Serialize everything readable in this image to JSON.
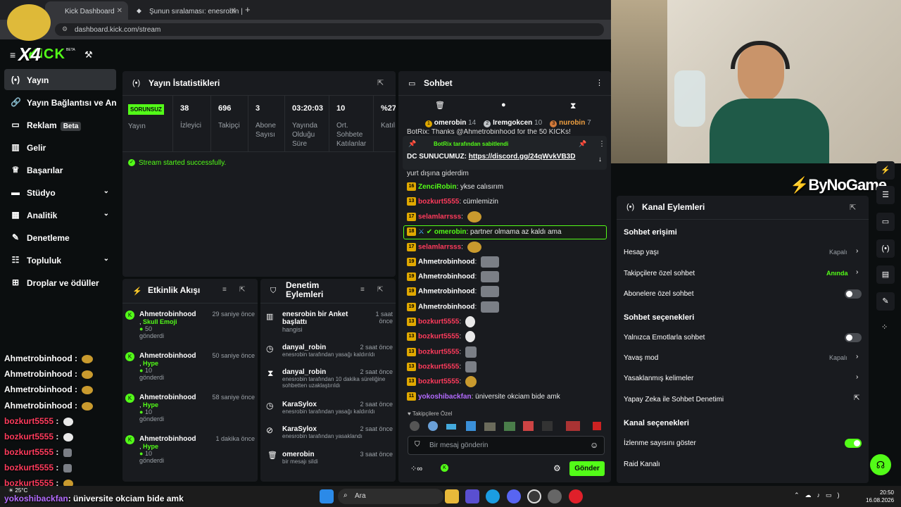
{
  "browser": {
    "tabs": [
      {
        "label": "Kick Dashboard"
      },
      {
        "label": "Şunun sıralaması: enesrobin | Yo"
      }
    ],
    "new_tab": "+",
    "url": "dashboard.kick.com/stream"
  },
  "header": {
    "logo": "KICK",
    "beta": "BETA"
  },
  "sidebar": {
    "items": [
      {
        "label": "Yayın",
        "icon": "broadcast-icon"
      },
      {
        "label": "Yayın Bağlantısı ve Anahtar",
        "icon": "link-icon"
      },
      {
        "label": "Reklam",
        "icon": "ad-icon",
        "badge": "Beta"
      },
      {
        "label": "Gelir",
        "icon": "chart-icon"
      },
      {
        "label": "Başarılar",
        "icon": "trophy-icon"
      },
      {
        "label": "Stüdyo",
        "icon": "studio-icon"
      },
      {
        "label": "Analitik",
        "icon": "analytics-icon"
      },
      {
        "label": "Denetleme",
        "icon": "wrench-icon"
      },
      {
        "label": "Topluluk",
        "icon": "community-icon"
      },
      {
        "label": "Droplar ve ödüller",
        "icon": "gift-icon"
      }
    ]
  },
  "stats": {
    "title": "Yayın İstatistikleri",
    "status_badge": "SORUNSUZ",
    "status_label": "Yayın",
    "items": [
      {
        "value": "38",
        "label": "İzleyici"
      },
      {
        "value": "696",
        "label": "Takipçi"
      },
      {
        "value": "3",
        "label": "Abone Sayısı"
      },
      {
        "value": "03:20:03",
        "label": "Yayında Olduğu Süre"
      },
      {
        "value": "10",
        "label": "Ort. Sohbete Katılanlar"
      },
      {
        "value": "%27",
        "label": "Katılı"
      }
    ],
    "success_msg": "Stream started successfully."
  },
  "activity": {
    "title": "Etkinlik Akışı",
    "events": [
      {
        "user": "Ahmetrobinhood",
        "item": "Skull Emoji",
        "amount": "50",
        "verb": "gönderdi",
        "time": "29 saniye önce"
      },
      {
        "user": "Ahmetrobinhood",
        "item": "Hype",
        "amount": "10",
        "verb": "gönderdi",
        "time": "50 saniye önce"
      },
      {
        "user": "Ahmetrobinhood",
        "item": "Hype",
        "amount": "10",
        "verb": "gönderdi",
        "time": "58 saniye önce"
      },
      {
        "user": "Ahmetrobinhood",
        "item": "Hype",
        "amount": "10",
        "verb": "gönderdi",
        "time": "1 dakika önce"
      }
    ]
  },
  "moderation": {
    "title": "Denetim Eylemleri",
    "actions": [
      {
        "user": "enesrobin",
        "action": "bir Anket başlattı",
        "detail": "hangisi",
        "time": "1 saat önce",
        "icon": "poll-icon"
      },
      {
        "user": "danyal_robin",
        "action": "",
        "detail": "enesrobin tarafından yasağı kaldırıldı",
        "time": "2 saat önce",
        "icon": "clock-icon"
      },
      {
        "user": "danyal_robin",
        "action": "",
        "detail": "enesrobin tarafından 10 dakika süreliğine sohbetten uzaklaştırıldı",
        "time": "2 saat önce",
        "icon": "hourglass-icon"
      },
      {
        "user": "KaraSylox",
        "action": "",
        "detail": "enesrobin tarafından yasağı kaldırıldı",
        "time": "2 saat önce",
        "icon": "clock-icon"
      },
      {
        "user": "KaraSylox",
        "action": "",
        "detail": "enesrobin tarafından yasaklandı",
        "time": "2 saat önce",
        "icon": "ban-icon"
      },
      {
        "user": "omerobin",
        "action": "",
        "detail": "bir mesajı sildi",
        "time": "3 saat önce",
        "icon": "trash-icon"
      }
    ]
  },
  "chat": {
    "title": "Sohbet",
    "leaderboard": [
      {
        "rank": "1",
        "name": "omerobin",
        "count": "14"
      },
      {
        "rank": "2",
        "name": "Iremgokcen",
        "count": "10"
      },
      {
        "rank": "3",
        "name": "nurobin",
        "count": "7"
      }
    ],
    "partial_top": "BotRix: Thanks @Ahmetrobinhood for the 50 KICKs!",
    "pinned_by": "BotRix tarafından sabitlendi",
    "pinned_msg": "DC SUNUCUMUZ: https://discord.gg/24qWvkVB3D",
    "pinned_prefix": "DC SUNUCUMUZ:",
    "pinned_link": "https://discord.gg/24qWvkVB3D",
    "partial_msg": "yurt dışına giderdim",
    "messages": [
      {
        "lvl": "16",
        "user": "ZenciRobin",
        "color": "#53fc18",
        "text": "ykse calısırım",
        "emote": ""
      },
      {
        "lvl": "13",
        "user": "bozkurt5555",
        "color": "#ff3b5c",
        "text": "cümlemizin",
        "emote": ""
      },
      {
        "lvl": "17",
        "user": "selamlarrsss",
        "color": "#ff3b5c",
        "text": "",
        "emote": "gold"
      },
      {
        "lvl": "18",
        "user": "omerobin",
        "color": "#53fc18",
        "text": "partner olmama az kaldı ama",
        "emote": "",
        "highlight": true
      },
      {
        "lvl": "17",
        "user": "selamlarrsss",
        "color": "#ff3b5c",
        "text": "",
        "emote": "gold"
      },
      {
        "lvl": "19",
        "user": "Ahmetrobinhood",
        "color": "#ffffff",
        "text": "",
        "emote": "gray"
      },
      {
        "lvl": "19",
        "user": "Ahmetrobinhood",
        "color": "#ffffff",
        "text": "",
        "emote": "gray"
      },
      {
        "lvl": "19",
        "user": "Ahmetrobinhood",
        "color": "#ffffff",
        "text": "",
        "emote": "gray"
      },
      {
        "lvl": "19",
        "user": "Ahmetrobinhood",
        "color": "#ffffff",
        "text": "",
        "emote": "gray"
      },
      {
        "lvl": "13",
        "user": "bozkurt5555",
        "color": "#ff3b5c",
        "text": "",
        "emote": "skull"
      },
      {
        "lvl": "13",
        "user": "bozkurt5555",
        "color": "#ff3b5c",
        "text": "",
        "emote": "skull"
      },
      {
        "lvl": "13",
        "user": "bozkurt5555",
        "color": "#ff3b5c",
        "text": "",
        "emote": "gray"
      },
      {
        "lvl": "13",
        "user": "bozkurt5555",
        "color": "#ff3b5c",
        "text": "",
        "emote": "gray"
      },
      {
        "lvl": "13",
        "user": "bozkurt5555",
        "color": "#ff3b5c",
        "text": "",
        "emote": "gold"
      },
      {
        "lvl": "11",
        "user": "yokoshibackfan",
        "color": "#b46bff",
        "text": "üniversite okciam bide amk",
        "emote": ""
      }
    ],
    "followers_only": "Takipçilere Özel",
    "placeholder": "Bir mesaj gönderin",
    "send": "Gönder"
  },
  "channel": {
    "watermark": "ByNoGame",
    "title": "Kanal Eylemleri",
    "sections": [
      {
        "heading": "Sohbet erişimi"
      },
      {
        "heading": "Sohbet seçenekleri"
      },
      {
        "heading": "Kanal seçenekleri"
      }
    ],
    "rows": [
      {
        "label": "Hesap yaşı",
        "value": "Kapalı"
      },
      {
        "label": "Takipçilere özel sohbet",
        "value": "Anında"
      },
      {
        "label": "Abonelere özel sohbet",
        "value": ""
      },
      {
        "label": "Yalnızca Emotlarla sohbet",
        "value": ""
      },
      {
        "label": "Yavaş mod",
        "value": "Kapalı"
      },
      {
        "label": "Yasaklanmış kelimeler",
        "value": ""
      },
      {
        "label": "Yapay Zeka ile Sohbet Denetimi",
        "value": ""
      },
      {
        "label": "İzlenme sayısını göster",
        "value": ""
      },
      {
        "label": "Raid Kanalı",
        "value": ""
      }
    ]
  },
  "overlay": {
    "badge": "X4",
    "lines": [
      {
        "user": "Ahmetrobinhood",
        "color": "#ffffff"
      },
      {
        "user": "Ahmetrobinhood",
        "color": "#ffffff"
      },
      {
        "user": "Ahmetrobinhood",
        "color": "#ffffff"
      },
      {
        "user": "Ahmetrobinhood",
        "color": "#ffffff"
      },
      {
        "user": "bozkurt5555",
        "color": "#ff3b5c"
      },
      {
        "user": "bozkurt5555",
        "color": "#ff3b5c"
      },
      {
        "user": "bozkurt5555",
        "color": "#ff3b5c"
      },
      {
        "user": "bozkurt5555",
        "color": "#ff3b5c"
      },
      {
        "user": "bozkurt5555",
        "color": "#ff3b5c"
      }
    ],
    "last_user": "yokoshibackfan",
    "last_text": "üniversite okciam bide amk"
  },
  "taskbar": {
    "weather": "25°C",
    "search": "Ara",
    "time": "20:50",
    "date": "16.08.2026"
  },
  "colors": {
    "accent": "#53fc18",
    "panel": "#191b1f",
    "bg": "#0b0e0f"
  }
}
